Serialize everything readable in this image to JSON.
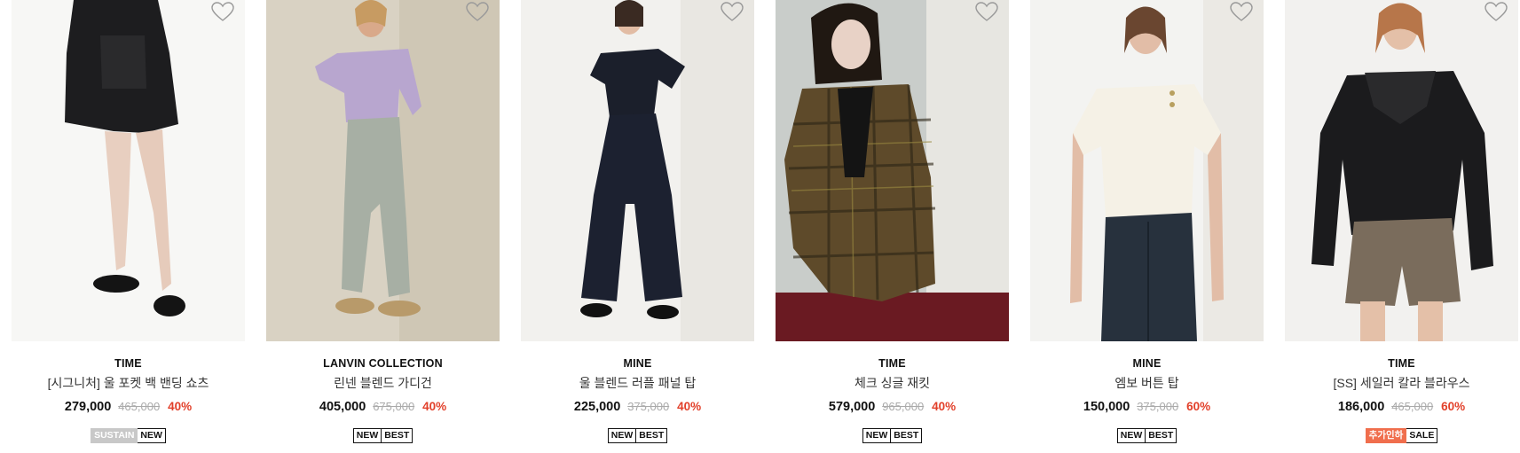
{
  "products": [
    {
      "brand": "TIME",
      "name": "[시그니처] 울 포켓 백 밴딩 쇼츠",
      "price": "279,000",
      "original_price": "465,000",
      "discount": "40%",
      "badges": [
        "SUSTAIN",
        "NEW"
      ]
    },
    {
      "brand": "LANVIN COLLECTION",
      "name": "린넨 블렌드 가디건",
      "price": "405,000",
      "original_price": "675,000",
      "discount": "40%",
      "badges": [
        "NEW",
        "BEST"
      ]
    },
    {
      "brand": "MINE",
      "name": "울 블렌드 러플 패널 탑",
      "price": "225,000",
      "original_price": "375,000",
      "discount": "40%",
      "badges": [
        "NEW",
        "BEST"
      ]
    },
    {
      "brand": "TIME",
      "name": "체크 싱글 재킷",
      "price": "579,000",
      "original_price": "965,000",
      "discount": "40%",
      "badges": [
        "NEW",
        "BEST"
      ]
    },
    {
      "brand": "MINE",
      "name": "엠보 버튼 탑",
      "price": "150,000",
      "original_price": "375,000",
      "discount": "60%",
      "badges": [
        "NEW",
        "BEST"
      ]
    },
    {
      "brand": "TIME",
      "name": "[SS] 세일러 칼라 블라우스",
      "price": "186,000",
      "original_price": "465,000",
      "discount": "60%",
      "badges": [
        "추가인하",
        "SALE"
      ]
    }
  ],
  "colors": {
    "discount": "#e2402a",
    "original_price": "#aaaaaa",
    "badge_sustain": "#c8c8c8",
    "badge_extra": "#f06e4d"
  },
  "icons": {
    "wishlist": "heart-outline-icon"
  }
}
